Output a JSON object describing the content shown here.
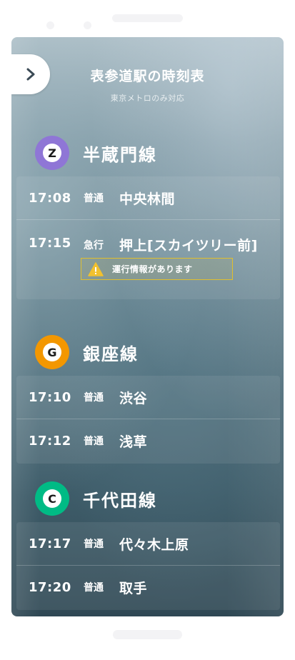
{
  "header": {
    "title": "表参道駅の時刻表",
    "subtitle": "東京メトロのみ対応"
  },
  "lines": [
    {
      "letter": "Z",
      "name": "半蔵門線",
      "color": "#8f76d6",
      "departures": [
        {
          "time": "17:08",
          "type": "普通",
          "destination": "中央林間"
        },
        {
          "time": "17:15",
          "type": "急行",
          "destination": "押上[スカイツリー前]",
          "alert": "運行情報があります"
        }
      ]
    },
    {
      "letter": "G",
      "name": "銀座線",
      "color": "#f39700",
      "departures": [
        {
          "time": "17:10",
          "type": "普通",
          "destination": "渋谷"
        },
        {
          "time": "17:12",
          "type": "普通",
          "destination": "浅草"
        }
      ]
    },
    {
      "letter": "C",
      "name": "千代田線",
      "color": "#00bb85",
      "departures": [
        {
          "time": "17:17",
          "type": "普通",
          "destination": "代々木上原"
        },
        {
          "time": "17:20",
          "type": "普通",
          "destination": "取手"
        }
      ]
    }
  ],
  "icons": {
    "back": "chevron-right-icon",
    "alert": "warning-triangle-icon"
  },
  "colors": {
    "alert_border": "#e0bf2e",
    "alert_icon": "#f2c12e"
  }
}
